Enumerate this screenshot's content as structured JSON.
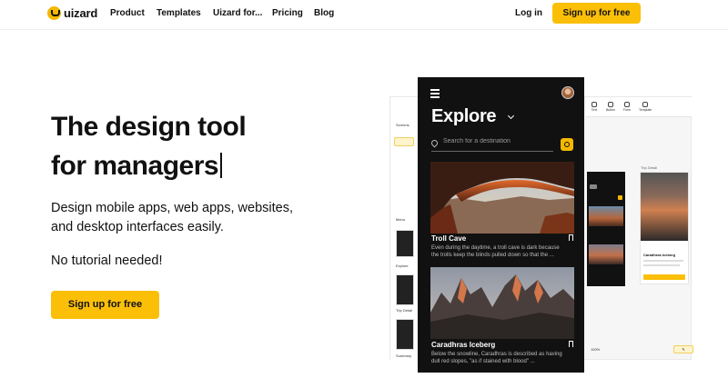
{
  "brand": {
    "name": "uizard"
  },
  "nav": {
    "links": [
      "Product",
      "Templates",
      "Uizard for...",
      "Pricing",
      "Blog"
    ],
    "login": "Log in",
    "signup": "Sign up for free"
  },
  "hero": {
    "title_line1": "The design tool",
    "title_line2": "for managers",
    "subtitle": "Design mobile apps, web apps, websites, and desktop interfaces easily.",
    "note": "No tutorial needed!",
    "cta": "Sign up for free"
  },
  "phone": {
    "title": "Explore",
    "search_placeholder": "Search for a destination",
    "cards": [
      {
        "title": "Troll Cave",
        "description": "Even during the daytime, a troll cave is dark because the trolls keep the blinds pulled down so that the ..."
      },
      {
        "title": "Caradhras Iceberg",
        "description": "Below the snowline, Caradhras is described as having dull red slopes, \"as if stained with blood\" ..."
      }
    ]
  },
  "editor": {
    "sidebar_labels": [
      "Screens",
      "Menu",
      "Explore",
      "Trip Detail",
      "Summary"
    ],
    "tools": [
      "Text",
      "Button",
      "Form",
      "Template"
    ],
    "zoom": "100%",
    "trip_detail_label": "Trip Detail",
    "secondary_card_title": "Caradhras Iceberg"
  },
  "colors": {
    "accent": "#fbbf08",
    "phone_bg": "#111111"
  }
}
